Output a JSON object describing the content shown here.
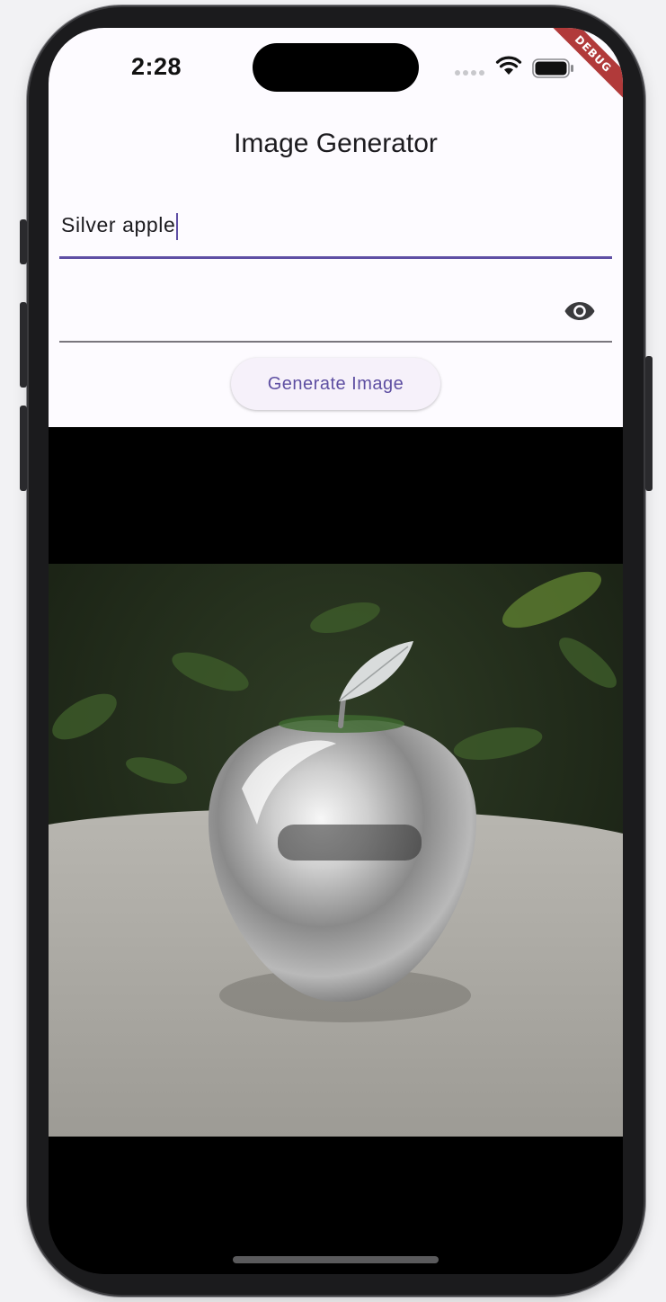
{
  "status_bar": {
    "time": "2:28",
    "debug_label": "DEBUG"
  },
  "app": {
    "title": "Image Generator",
    "prompt_value": "Silver apple",
    "api_key_masked": true,
    "generate_label": "Generate Image"
  },
  "image": {
    "alt": "Silver apple"
  },
  "colors": {
    "accent": "#5f4fa5",
    "app_background": "#fdfbff",
    "debug_banner": "#b13a3a"
  },
  "icons": {
    "visibility_toggle": "eye-icon",
    "wifi": "wifi-icon",
    "battery": "battery-icon"
  }
}
